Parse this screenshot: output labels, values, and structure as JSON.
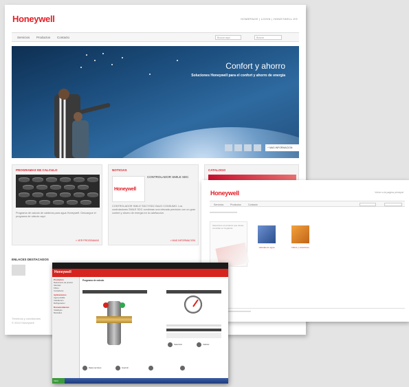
{
  "card1": {
    "logo": "Honeywell",
    "top_links": "HOMEPAGE | LOGIN | HONEYWELL.ES",
    "nav": [
      "Servicios",
      "Productos",
      "Contacto"
    ],
    "search_left": "Buscar aqui",
    "search_right": "Buscar",
    "hero": {
      "title": "Confort y ahorro",
      "subtitle": "Soluciones Honeywell para el confort y ahorro de energia",
      "more_button": "+ MAS INFORMACION"
    },
    "panels": [
      {
        "heading": "PROGRAMAS DE CALCULO",
        "body": "Programa de calculo de calderas para agua Honeywell. Descargue el programa de cálculo aqui.",
        "more": "> VER PROGRAMAS"
      },
      {
        "heading": "NOTICIAS",
        "news_title": "CONTROLADOR SMILE SDC",
        "body": "CONTROLADOR SMILE SDC7/SDC BAJO CONSUMO. Los controladores SMILE SDC combinan una elevada precision con un gran confort y ahorro de energia en la calefaccion.",
        "more": "> MAS INFORMACION"
      },
      {
        "heading": "CATALOGO"
      }
    ],
    "footer_heading": "ENLACES DESTACADOS",
    "footer_text": "Términos y condiciones\n© 2010 Honeywell"
  },
  "card2": {
    "logo": "Honeywell",
    "top_links": "Volver a la pagina principal",
    "nav": [
      "Servicios",
      "Productos",
      "Contacto"
    ],
    "side_text": "Seleccione el producto que desea consultar en la galeria",
    "thumbs": [
      {
        "caption": "Valvulas de agua"
      },
      {
        "caption": "Filtros y reductores"
      }
    ]
  },
  "card3": {
    "window_title": "Honeywell",
    "section_title": "Programa de calculo",
    "sidebar_sections": [
      {
        "heading": "Productos",
        "items": [
          "Reductores de presion",
          "Valvulas",
          "Filtros",
          "Contadores"
        ]
      },
      {
        "heading": "Aplicaciones",
        "items": [
          "Agua potable",
          "Calefaccion",
          "Refrigeracion"
        ]
      },
      {
        "heading": "Documentacion",
        "items": [
          "Catalogos",
          "Manuales"
        ]
      }
    ],
    "panel_left": "Filtro y reductor de presion",
    "panel_right": "Manometro",
    "buttons": [
      "Seleccion",
      "Calculo",
      "Datos tecnicos",
      "Imprimir"
    ],
    "start_label": "Inicio"
  },
  "colors": {
    "brand_red": "#e41e26",
    "hero_blue": "#1c4e7e",
    "taskbar_blue": "#1e3c7c"
  }
}
